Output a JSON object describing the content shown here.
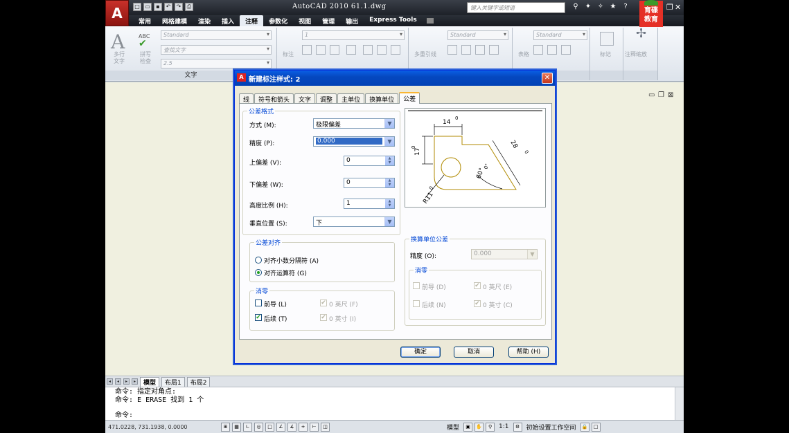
{
  "titlebar": {
    "title": "AutoCAD 2010   61.1.dwg",
    "search_placeholder": "键入关键字或短语",
    "watermark": "育碟教育"
  },
  "ribbon_tabs": [
    "常用",
    "网格建模",
    "渲染",
    "插入",
    "注释",
    "参数化",
    "视图",
    "管理",
    "输出",
    "Express Tools"
  ],
  "active_ribbon_tab": "注释",
  "ribbon": {
    "text_panel": {
      "multiline_label": "多行\n文字",
      "spell_label": "拼写\n检查",
      "style_combo": "Standard",
      "find_combo": "查找文字",
      "height_combo": "2.5",
      "footer": "文字"
    },
    "dim_panel": {
      "dim_label": "标注",
      "combo": "1"
    },
    "leader_panel": {
      "label": "多重引线",
      "combo": "Standard"
    },
    "table_panel": {
      "label": "表格",
      "combo": "Standard"
    },
    "mark_panel": {
      "label": "标记"
    },
    "scale_panel": {
      "label": "注释缩放"
    }
  },
  "dialog": {
    "title": "新建标注样式: 2",
    "tabs": [
      "线",
      "符号和箭头",
      "文字",
      "调整",
      "主单位",
      "换算单位",
      "公差"
    ],
    "active_tab": "公差",
    "tolerance_format": {
      "group_title": "公差格式",
      "method_label": "方式 (M):",
      "method_value": "极限偏差",
      "precision_label": "精度 (P):",
      "precision_value": "0.000",
      "upper_label": "上偏差 (V):",
      "upper_value": "0",
      "lower_label": "下偏差 (W):",
      "lower_value": "0",
      "height_label": "高度比例 (H):",
      "height_value": "1",
      "vertical_label": "垂直位置 (S):",
      "vertical_value": "下"
    },
    "alignment": {
      "group_title": "公差对齐",
      "opt1": "对齐小数分隔符 (A)",
      "opt2": "对齐运算符 (G)",
      "selected": "对齐运算符 (G)"
    },
    "zero_suppress": {
      "group_title": "消零",
      "leading": "前导 (L)",
      "leading_checked": false,
      "trailing": "后续 (T)",
      "trailing_checked": true,
      "feet": "0 英尺 (F)",
      "inches": "0 英寸 (I)"
    },
    "alt_tolerance": {
      "group_title": "换算单位公差",
      "precision_label": "精度 (O):",
      "precision_value": "0.000",
      "zero_title": "消零",
      "leading": "前导 (D)",
      "trailing": "后续 (N)",
      "feet": "0 英尺 (E)",
      "inches": "0 英寸 (C)"
    },
    "preview": {
      "dim_top": "14",
      "dim_top_tol": "0",
      "dim_left": "17",
      "dim_left_tol": "0",
      "dim_right": "28",
      "dim_right_tol": "0",
      "dim_angle": "60°",
      "dim_angle_tol": "0°",
      "dim_radius": "R11",
      "dim_radius_tol": "0"
    },
    "buttons": {
      "ok": "确定",
      "cancel": "取消",
      "help": "帮助 (H)"
    }
  },
  "layout_tabs": [
    "模型",
    "布局1",
    "布局2"
  ],
  "command_lines": [
    "命令: 指定对角点:",
    "命令: E ERASE 找到 1 个",
    "命令:"
  ],
  "status": {
    "coords": "471.0228, 731.1938, 0.0000",
    "model": "模型",
    "scale": "1:1",
    "workspace": "初始设置工作空间"
  }
}
